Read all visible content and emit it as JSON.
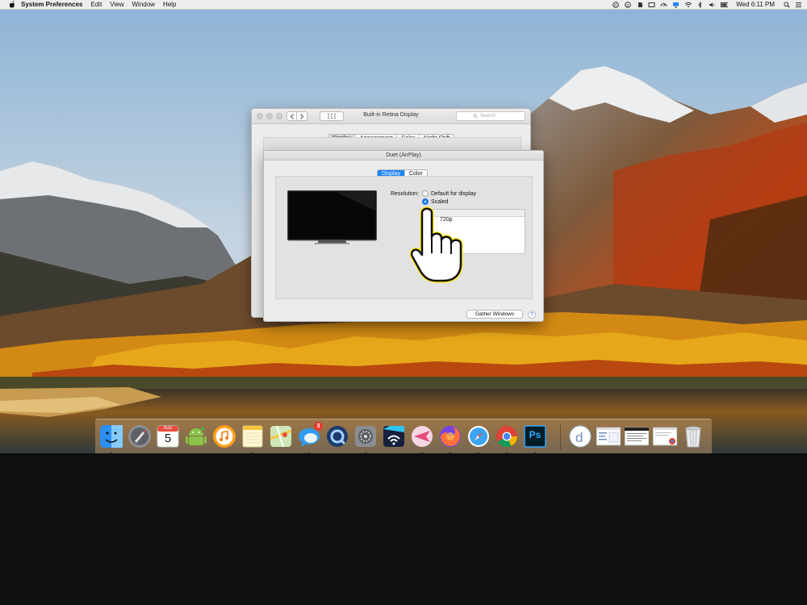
{
  "menubar": {
    "app_name": "System Preferences",
    "menus": [
      "Edit",
      "View",
      "Window",
      "Help"
    ],
    "clock": "Wed 6:11 PM"
  },
  "window_back": {
    "title": "Built-in Retina Display",
    "search_placeholder": "Search",
    "tabs": [
      "Display",
      "Arrangement",
      "Color",
      "Night Shift"
    ],
    "selected_tab": "Display"
  },
  "window_front": {
    "title": "Duet (AirPlay)",
    "tabs": [
      "Display",
      "Color"
    ],
    "selected_tab": "Display",
    "resolution_label": "Resolution:",
    "options": [
      "Default for display",
      "Scaled"
    ],
    "selected_option": "Scaled",
    "scaled_list_first": "720p",
    "gather_button": "Gather Windows",
    "help_button": "?"
  },
  "dock": {
    "items": [
      {
        "name": "Finder",
        "running": true
      },
      {
        "name": "Launchpad",
        "running": false
      },
      {
        "name": "Calendar",
        "running": false,
        "text": "5",
        "month": "AUG"
      },
      {
        "name": "Android File Transfer",
        "running": false
      },
      {
        "name": "iTunes",
        "running": false
      },
      {
        "name": "Notes",
        "running": true
      },
      {
        "name": "Maps",
        "running": false
      },
      {
        "name": "Messages",
        "running": true,
        "badge": "3"
      },
      {
        "name": "QuickTime Player",
        "running": false
      },
      {
        "name": "System Preferences",
        "running": true
      },
      {
        "name": "Duet Display",
        "running": false
      },
      {
        "name": "Kite",
        "running": true
      },
      {
        "name": "Firefox",
        "running": true
      },
      {
        "name": "Safari",
        "running": true
      },
      {
        "name": "Chrome",
        "running": true
      },
      {
        "name": "Photoshop",
        "running": true,
        "text": "Ps"
      }
    ],
    "right_items": [
      "Duet",
      "Window 1",
      "Window 2",
      "Window 3",
      "Trash"
    ]
  },
  "colors": {
    "accent": "#1d84f5",
    "badge": "#e53a2e"
  }
}
